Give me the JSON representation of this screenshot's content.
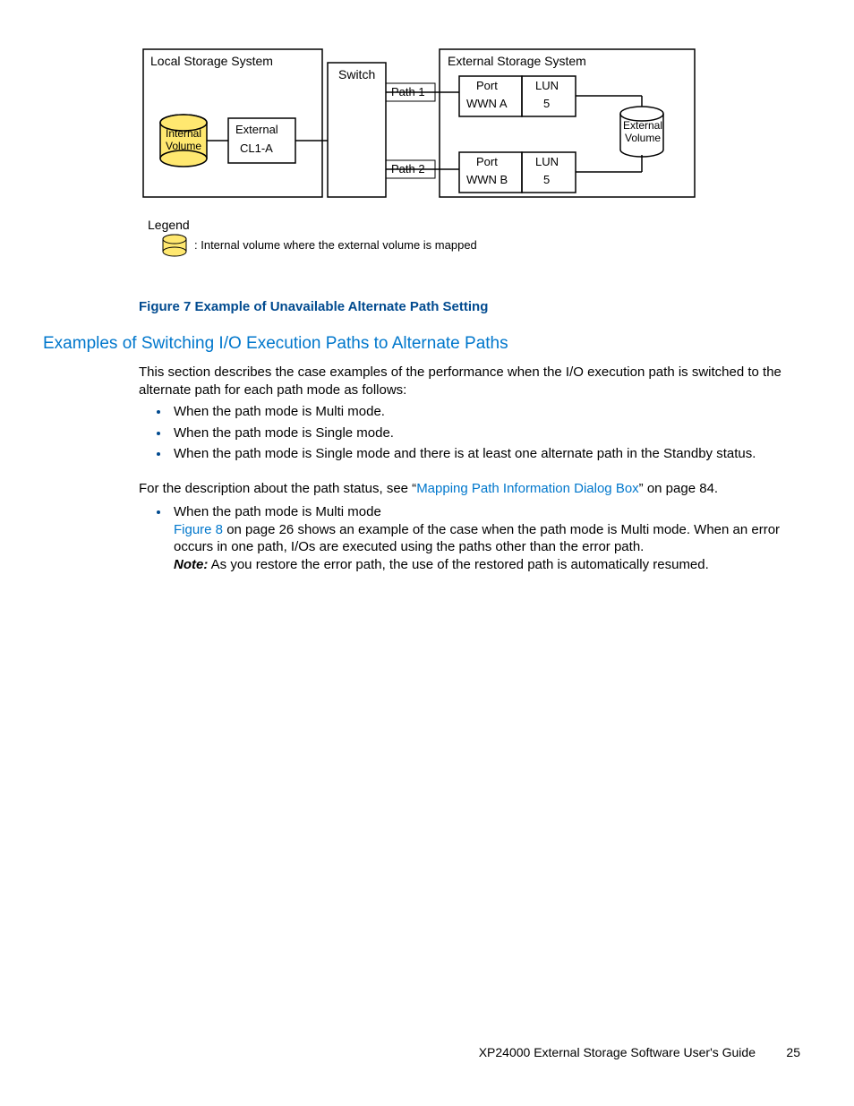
{
  "diagram": {
    "local_system": "Local Storage System",
    "internal_volume": "Internal Volume",
    "external_label": "External",
    "cl1a": "CL1-A",
    "switch": "Switch",
    "path1": "Path 1",
    "path2": "Path 2",
    "external_system": "External Storage System",
    "port_label": "Port",
    "wwn_a": "WWN A",
    "wwn_b": "WWN B",
    "lun_label": "LUN",
    "lun_val": "5",
    "external_volume": "External Volume",
    "legend_title": "Legend",
    "legend_text": ": Internal volume where the external volume is mapped"
  },
  "figure_caption": "Figure 7 Example of Unavailable Alternate Path Setting",
  "section_heading": "Examples of Switching I/O Execution Paths to Alternate Paths",
  "intro_p": "This section describes the case examples of the performance when the I/O execution path is switched to the alternate path for each path mode as follows:",
  "bullets": {
    "b1": "When the path mode is Multi mode.",
    "b2": "When the path mode is Single mode.",
    "b3": "When the path mode is Single mode and there is at least one alternate path in the Standby status."
  },
  "desc_p_pre": "For the description about the path status, see “",
  "desc_link": "Mapping Path Information Dialog Box",
  "desc_p_post": "” on page 84.",
  "second_list": {
    "heading": "When the path mode is Multi mode",
    "figlink": "Figure 8",
    "line1_post": " on page 26 shows an example of the case when the path mode is Multi mode.  When an error occurs in one path, I/Os are executed using the paths other than the error path.",
    "note_label": "Note:",
    "note_text": " As you restore the error path, the use of the restored path is automatically resumed."
  },
  "footer": {
    "doc": "XP24000 External Storage Software User's Guide",
    "page": "25"
  }
}
